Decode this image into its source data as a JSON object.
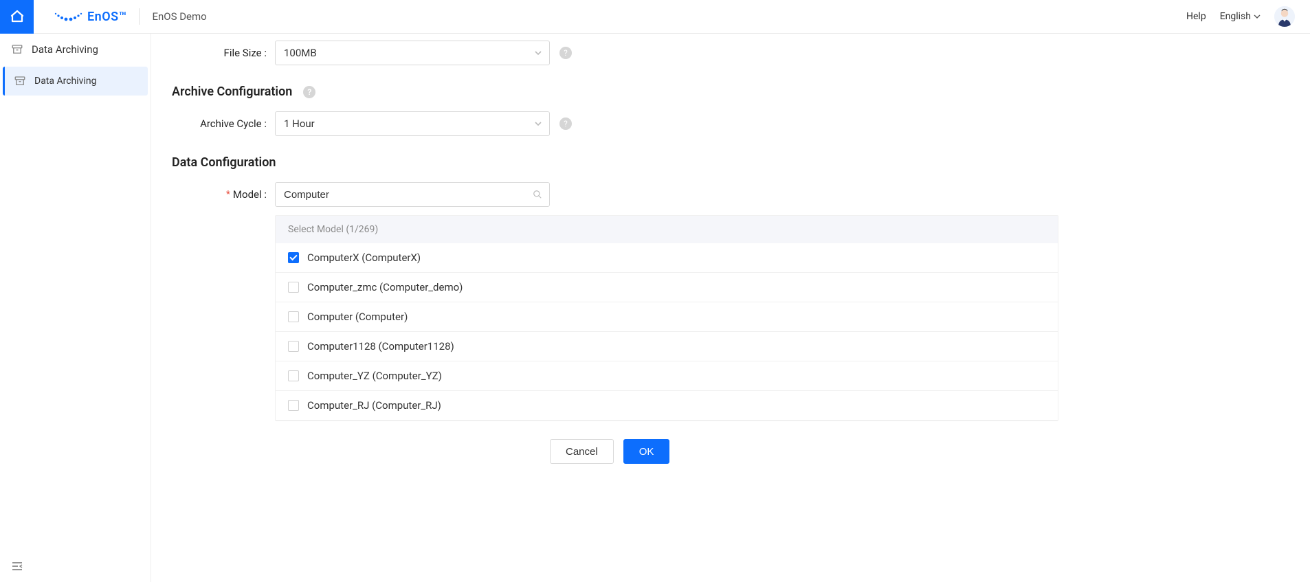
{
  "header": {
    "logo_text": "EnOS™",
    "app_title": "EnOS Demo",
    "help_label": "Help",
    "language_label": "English"
  },
  "sidebar": {
    "title": "Data Archiving",
    "items": [
      {
        "label": "Data Archiving",
        "active": true
      }
    ]
  },
  "form": {
    "file_size": {
      "label": "File Size :",
      "value": "100MB"
    },
    "archive_section_title": "Archive Configuration",
    "archive_cycle": {
      "label": "Archive Cycle :",
      "value": "1 Hour"
    },
    "data_section_title": "Data Configuration",
    "model": {
      "label": "Model :",
      "value": "Computer",
      "required": true
    },
    "model_panel_header": "Select Model (1/269)",
    "models": [
      {
        "label": "ComputerX (ComputerX)",
        "checked": true
      },
      {
        "label": "Computer_zmc (Computer_demo)",
        "checked": false
      },
      {
        "label": "Computer (Computer)",
        "checked": false
      },
      {
        "label": "Computer1128 (Computer1128)",
        "checked": false
      },
      {
        "label": "Computer_YZ (Computer_YZ)",
        "checked": false
      },
      {
        "label": "Computer_RJ (Computer_RJ)",
        "checked": false
      }
    ],
    "actions": {
      "cancel": "Cancel",
      "ok": "OK"
    }
  }
}
